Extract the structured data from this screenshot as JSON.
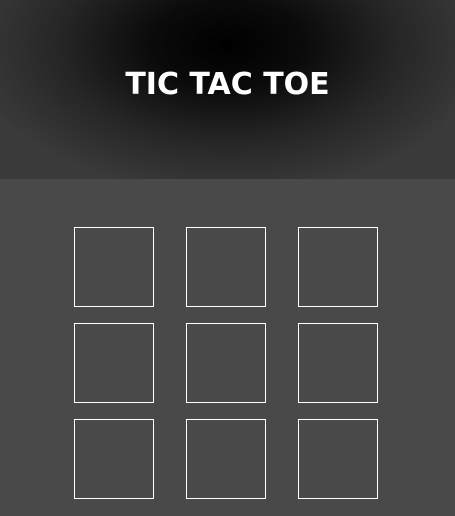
{
  "header": {
    "title": "TIC TAC TOE"
  },
  "board": {
    "cells": [
      "",
      "",
      "",
      "",
      "",
      "",
      "",
      "",
      ""
    ]
  },
  "colors": {
    "background": "#4a4949",
    "header_center": "#000000",
    "cell_border": "#ffffff",
    "title_text": "#ffffff"
  }
}
